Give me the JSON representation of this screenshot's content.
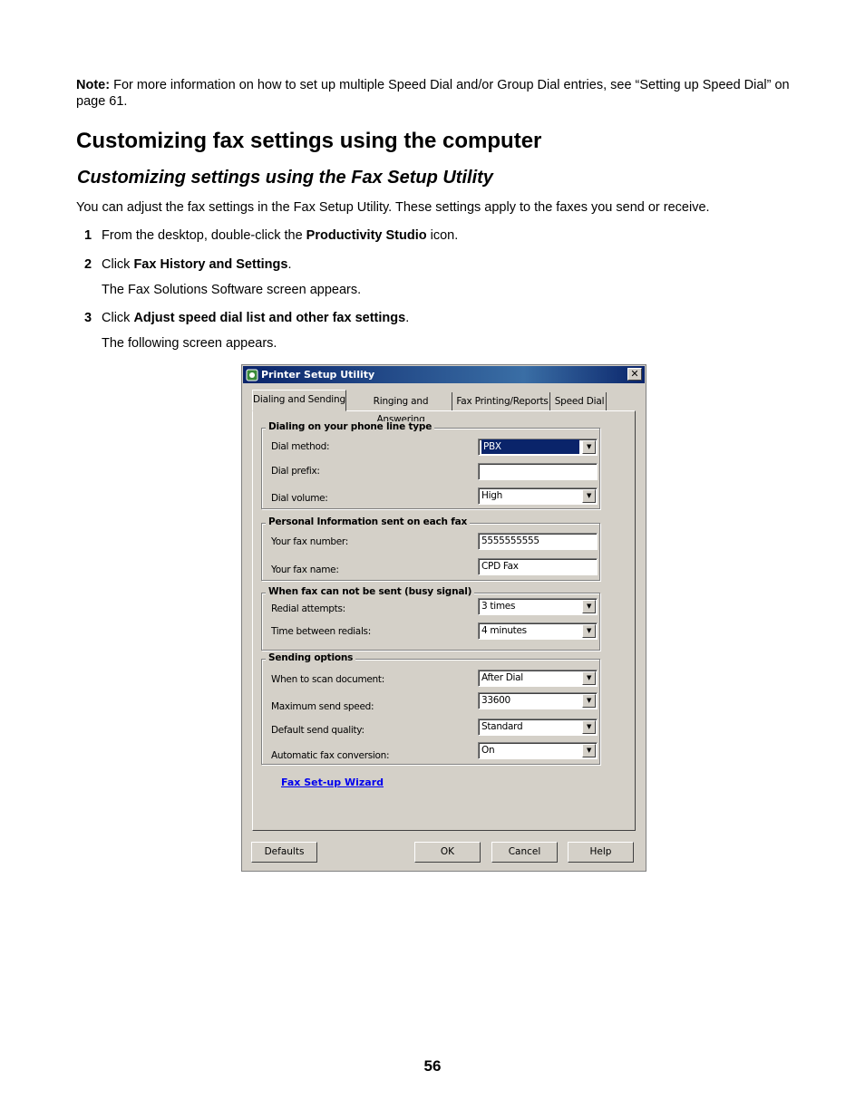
{
  "note": {
    "label": "Note:",
    "text": " For more information on how to set up multiple Speed Dial and/or Group Dial entries, see “Setting up Speed Dial” on page 61."
  },
  "heading1": "Customizing fax settings using the computer",
  "heading2": "Customizing settings using the Fax Setup Utility",
  "intro": "You can adjust the fax settings in the Fax Setup Utility. These settings apply to the faxes you send or receive.",
  "steps": [
    {
      "num": "1",
      "pre": "From the desktop, double-click the ",
      "bold": "Productivity Studio",
      "post": " icon.",
      "result": ""
    },
    {
      "num": "2",
      "pre": "Click ",
      "bold": "Fax History and Settings",
      "post": ".",
      "result": "The Fax Solutions Software screen appears."
    },
    {
      "num": "3",
      "pre": "Click ",
      "bold": "Adjust speed dial list and other fax settings",
      "post": ".",
      "result": "The following screen appears."
    }
  ],
  "dialog": {
    "title": "Printer Setup Utility",
    "close": "✕",
    "tabs": [
      "Dialing and Sending",
      "Ringing and Answering",
      "Fax Printing/Reports",
      "Speed Dial"
    ],
    "groups": {
      "dialing": {
        "label": "Dialing on your phone line type",
        "dial_method": {
          "label": "Dial method:",
          "value": "PBX"
        },
        "dial_prefix": {
          "label": "Dial prefix:",
          "value": ""
        },
        "dial_volume": {
          "label": "Dial volume:",
          "value": "High"
        }
      },
      "personal": {
        "label": "Personal Information sent on each fax",
        "fax_number": {
          "label": "Your fax number:",
          "value": "5555555555"
        },
        "fax_name": {
          "label": "Your fax name:",
          "value": "CPD Fax"
        }
      },
      "busy": {
        "label": "When fax can not be sent (busy signal)",
        "redial_attempts": {
          "label": "Redial attempts:",
          "value": "3 times"
        },
        "time_between": {
          "label": "Time between redials:",
          "value": "4 minutes"
        }
      },
      "sending": {
        "label": "Sending options",
        "scan_when": {
          "label": "When to scan document:",
          "value": "After Dial"
        },
        "max_speed": {
          "label": "Maximum send speed:",
          "value": "33600"
        },
        "quality": {
          "label": "Default send quality:",
          "value": "Standard"
        },
        "conversion": {
          "label": "Automatic fax conversion:",
          "value": "On"
        }
      }
    },
    "wizard_link": "Fax Set-up Wizard",
    "buttons": {
      "defaults": "Defaults",
      "ok": "OK",
      "cancel": "Cancel",
      "help": "Help"
    },
    "dropdown_arrow": "▼"
  },
  "page_number": "56"
}
